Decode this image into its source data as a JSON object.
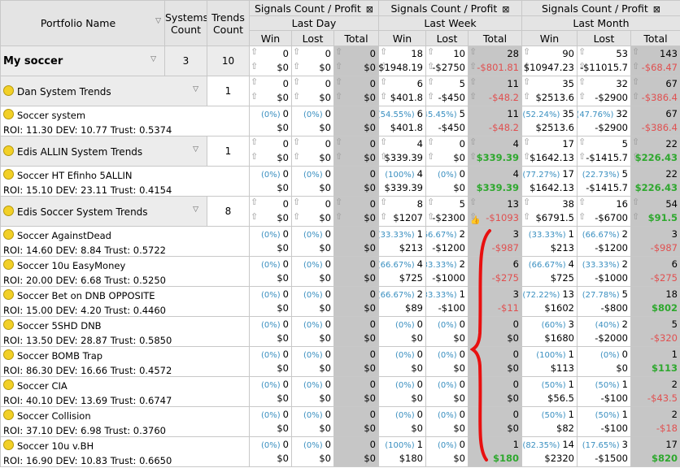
{
  "header": {
    "portfolio_name": "Portfolio Name",
    "systems_count": [
      "Systems",
      "Count"
    ],
    "trends_count": [
      "Trends",
      "Count"
    ],
    "signals_label": "Signals Count / Profit",
    "periods": [
      "Last Day",
      "Last Week",
      "Last Month"
    ],
    "cols": [
      "Win",
      "Lost",
      "Total"
    ]
  },
  "rows": [
    {
      "type": "portfolio",
      "name": "My soccer",
      "systems": "3",
      "trends": "10",
      "cells": [
        [
          "0",
          "$0"
        ],
        [
          "0",
          "$0"
        ],
        [
          "0",
          "$0"
        ],
        [
          "18",
          "$1948.19"
        ],
        [
          "10",
          "-$2750"
        ],
        [
          "28",
          "-$801.81"
        ],
        [
          "90",
          "$10947.23"
        ],
        [
          "53",
          "-$11015.7"
        ],
        [
          "143",
          "-$68.47"
        ]
      ],
      "pcts": [
        "",
        "",
        "",
        "",
        "",
        "",
        "",
        "",
        ""
      ]
    },
    {
      "type": "group",
      "name": "Dan System Trends",
      "trends": "1",
      "cells": [
        [
          "0",
          "$0"
        ],
        [
          "0",
          "$0"
        ],
        [
          "0",
          "$0"
        ],
        [
          "6",
          "$401.8"
        ],
        [
          "5",
          "-$450"
        ],
        [
          "11",
          "-$48.2"
        ],
        [
          "35",
          "$2513.6"
        ],
        [
          "32",
          "-$2900"
        ],
        [
          "67",
          "-$386.4"
        ]
      ],
      "pcts": [
        "",
        "",
        "",
        "",
        "",
        "",
        "",
        "",
        ""
      ]
    },
    {
      "type": "system",
      "name": "Soccer system",
      "stats": "ROI: 11.30 DEV: 10.77 Trust: 0.5374",
      "cells": [
        [
          "0",
          "$0"
        ],
        [
          "0",
          "$0"
        ],
        [
          "0",
          "$0"
        ],
        [
          "6",
          "$401.8"
        ],
        [
          "5",
          "-$450"
        ],
        [
          "11",
          "-$48.2"
        ],
        [
          "35",
          "$2513.6"
        ],
        [
          "32",
          "-$2900"
        ],
        [
          "67",
          "-$386.4"
        ]
      ],
      "pcts": [
        "(0%)",
        "(0%)",
        "",
        "(54.55%)",
        "(45.45%)",
        "",
        "(52.24%)",
        "(47.76%)",
        ""
      ]
    },
    {
      "type": "group",
      "name": "Edis ALLIN System Trends",
      "trends": "1",
      "cells": [
        [
          "0",
          "$0"
        ],
        [
          "0",
          "$0"
        ],
        [
          "0",
          "$0"
        ],
        [
          "4",
          "$339.39"
        ],
        [
          "0",
          "$0"
        ],
        [
          "4",
          "$339.39"
        ],
        [
          "17",
          "$1642.13"
        ],
        [
          "5",
          "-$1415.7"
        ],
        [
          "22",
          "$226.43"
        ]
      ],
      "pcts": [
        "",
        "",
        "",
        "",
        "",
        "",
        "",
        "",
        ""
      ]
    },
    {
      "type": "system",
      "name": "Soccer HT Efinho 5ALLIN",
      "stats": "ROI: 15.10 DEV: 23.11 Trust: 0.4154",
      "cells": [
        [
          "0",
          "$0"
        ],
        [
          "0",
          "$0"
        ],
        [
          "0",
          "$0"
        ],
        [
          "4",
          "$339.39"
        ],
        [
          "0",
          "$0"
        ],
        [
          "4",
          "$339.39"
        ],
        [
          "17",
          "$1642.13"
        ],
        [
          "5",
          "-$1415.7"
        ],
        [
          "22",
          "$226.43"
        ]
      ],
      "pcts": [
        "(0%)",
        "(0%)",
        "",
        "(100%)",
        "(0%)",
        "",
        "(77.27%)",
        "(22.73%)",
        ""
      ]
    },
    {
      "type": "group",
      "name": "Edis Soccer System Trends",
      "trends": "8",
      "cells": [
        [
          "0",
          "$0"
        ],
        [
          "0",
          "$0"
        ],
        [
          "0",
          "$0"
        ],
        [
          "8",
          "$1207"
        ],
        [
          "5",
          "-$2300"
        ],
        [
          "13",
          "-$1093"
        ],
        [
          "38",
          "$6791.5"
        ],
        [
          "16",
          "-$6700"
        ],
        [
          "54",
          "$91.5"
        ]
      ],
      "pcts": [
        "",
        "",
        "",
        "",
        "",
        "",
        "",
        "",
        ""
      ]
    },
    {
      "type": "system",
      "name": "Soccer AgainstDead",
      "stats": "ROI: 14.60 DEV: 8.84 Trust: 0.5722",
      "cells": [
        [
          "0",
          "$0"
        ],
        [
          "0",
          "$0"
        ],
        [
          "0",
          "$0"
        ],
        [
          "1",
          "$213"
        ],
        [
          "2",
          "-$1200"
        ],
        [
          "3",
          "-$987"
        ],
        [
          "1",
          "$213"
        ],
        [
          "2",
          "-$1200"
        ],
        [
          "3",
          "-$987"
        ]
      ],
      "pcts": [
        "(0%)",
        "(0%)",
        "",
        "(33.33%)",
        "(66.67%)",
        "",
        "(33.33%)",
        "(66.67%)",
        ""
      ]
    },
    {
      "type": "system",
      "name": "Soccer 10u EasyMoney",
      "stats": "ROI: 20.00 DEV: 6.68 Trust: 0.5250",
      "cells": [
        [
          "0",
          "$0"
        ],
        [
          "0",
          "$0"
        ],
        [
          "0",
          "$0"
        ],
        [
          "4",
          "$725"
        ],
        [
          "2",
          "-$1000"
        ],
        [
          "6",
          "-$275"
        ],
        [
          "4",
          "$725"
        ],
        [
          "2",
          "-$1000"
        ],
        [
          "6",
          "-$275"
        ]
      ],
      "pcts": [
        "(0%)",
        "(0%)",
        "",
        "(66.67%)",
        "(33.33%)",
        "",
        "(66.67%)",
        "(33.33%)",
        ""
      ]
    },
    {
      "type": "system",
      "name": "Soccer Bet on DNB OPPOSITE",
      "stats": "ROI: 15.00 DEV: 4.20 Trust: 0.4460",
      "cells": [
        [
          "0",
          "$0"
        ],
        [
          "0",
          "$0"
        ],
        [
          "0",
          "$0"
        ],
        [
          "2",
          "$89"
        ],
        [
          "1",
          "-$100"
        ],
        [
          "3",
          "-$11"
        ],
        [
          "13",
          "$1602"
        ],
        [
          "5",
          "-$800"
        ],
        [
          "18",
          "$802"
        ]
      ],
      "pcts": [
        "(0%)",
        "(0%)",
        "",
        "(66.67%)",
        "(33.33%)",
        "",
        "(72.22%)",
        "(27.78%)",
        ""
      ]
    },
    {
      "type": "system",
      "name": "Soccer 5SHD DNB",
      "stats": "ROI: 13.50 DEV: 28.87 Trust: 0.5850",
      "cells": [
        [
          "0",
          "$0"
        ],
        [
          "0",
          "$0"
        ],
        [
          "0",
          "$0"
        ],
        [
          "0",
          "$0"
        ],
        [
          "0",
          "$0"
        ],
        [
          "0",
          "$0"
        ],
        [
          "3",
          "$1680"
        ],
        [
          "2",
          "-$2000"
        ],
        [
          "5",
          "-$320"
        ]
      ],
      "pcts": [
        "(0%)",
        "(0%)",
        "",
        "(0%)",
        "(0%)",
        "",
        "(60%)",
        "(40%)",
        ""
      ]
    },
    {
      "type": "system",
      "name": "Soccer BOMB Trap",
      "stats": "ROI: 86.30 DEV: 16.66 Trust: 0.4572",
      "cells": [
        [
          "0",
          "$0"
        ],
        [
          "0",
          "$0"
        ],
        [
          "0",
          "$0"
        ],
        [
          "0",
          "$0"
        ],
        [
          "0",
          "$0"
        ],
        [
          "0",
          "$0"
        ],
        [
          "1",
          "$113"
        ],
        [
          "0",
          "$0"
        ],
        [
          "1",
          "$113"
        ]
      ],
      "pcts": [
        "(0%)",
        "(0%)",
        "",
        "(0%)",
        "(0%)",
        "",
        "(100%)",
        "(0%)",
        ""
      ]
    },
    {
      "type": "system",
      "name": "Soccer CIA",
      "stats": "ROI: 40.10 DEV: 13.69 Trust: 0.6747",
      "cells": [
        [
          "0",
          "$0"
        ],
        [
          "0",
          "$0"
        ],
        [
          "0",
          "$0"
        ],
        [
          "0",
          "$0"
        ],
        [
          "0",
          "$0"
        ],
        [
          "0",
          "$0"
        ],
        [
          "1",
          "$56.5"
        ],
        [
          "1",
          "-$100"
        ],
        [
          "2",
          "-$43.5"
        ]
      ],
      "pcts": [
        "(0%)",
        "(0%)",
        "",
        "(0%)",
        "(0%)",
        "",
        "(50%)",
        "(50%)",
        ""
      ]
    },
    {
      "type": "system",
      "name": "Soccer Collision",
      "stats": "ROI: 37.10 DEV: 6.98 Trust: 0.3760",
      "cells": [
        [
          "0",
          "$0"
        ],
        [
          "0",
          "$0"
        ],
        [
          "0",
          "$0"
        ],
        [
          "0",
          "$0"
        ],
        [
          "0",
          "$0"
        ],
        [
          "0",
          "$0"
        ],
        [
          "1",
          "$82"
        ],
        [
          "1",
          "-$100"
        ],
        [
          "2",
          "-$18"
        ]
      ],
      "pcts": [
        "(0%)",
        "(0%)",
        "",
        "(0%)",
        "(0%)",
        "",
        "(50%)",
        "(50%)",
        ""
      ]
    },
    {
      "type": "system",
      "name": "Soccer 10u v.BH",
      "stats": "ROI: 16.90 DEV: 10.83 Trust: 0.6650",
      "cells": [
        [
          "0",
          "$0"
        ],
        [
          "0",
          "$0"
        ],
        [
          "0",
          "$0"
        ],
        [
          "1",
          "$180"
        ],
        [
          "0",
          "$0"
        ],
        [
          "1",
          "$180"
        ],
        [
          "14",
          "$2320"
        ],
        [
          "3",
          "-$1500"
        ],
        [
          "17",
          "$820"
        ]
      ],
      "pcts": [
        "(0%)",
        "(0%)",
        "",
        "(100%)",
        "(0%)",
        "",
        "(82.35%)",
        "(17.65%)",
        ""
      ]
    }
  ]
}
